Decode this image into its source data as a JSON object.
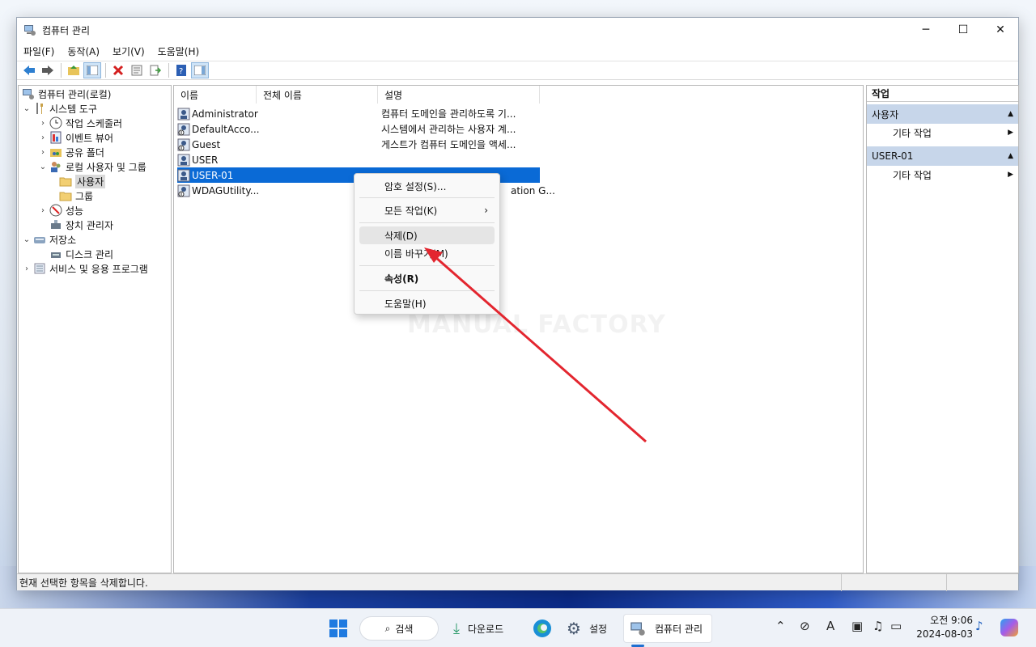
{
  "window": {
    "title": "컴퓨터 관리",
    "minimize": "─",
    "maximize": "☐",
    "close": "✕"
  },
  "menubar": [
    "파일(F)",
    "동작(A)",
    "보기(V)",
    "도움말(H)"
  ],
  "tree": {
    "root": "컴퓨터 관리(로컬)",
    "system_tools": "시스템 도구",
    "task_scheduler": "작업 스케줄러",
    "event_viewer": "이벤트 뷰어",
    "shared_folders": "공유 폴더",
    "local_users_groups": "로컬 사용자 및 그룹",
    "users": "사용자",
    "groups": "그룹",
    "performance": "성능",
    "device_manager": "장치 관리자",
    "storage": "저장소",
    "disk_management": "디스크 관리",
    "services_apps": "서비스 및 응용 프로그램"
  },
  "list": {
    "headers": [
      "이름",
      "전체 이름",
      "설명"
    ],
    "rows": [
      {
        "name": "Administrator",
        "full_name": "",
        "description": "컴퓨터 도메인을 관리하도록 기..."
      },
      {
        "name": "DefaultAcco...",
        "full_name": "",
        "description": "시스템에서 관리하는 사용자 계..."
      },
      {
        "name": "Guest",
        "full_name": "",
        "description": "게스트가 컴퓨터 도메인을 액세..."
      },
      {
        "name": "USER",
        "full_name": "",
        "description": ""
      },
      {
        "name": "USER-01",
        "full_name": "",
        "description": ""
      },
      {
        "name": "WDAGUtility...",
        "full_name": "",
        "description": "ation G..."
      }
    ]
  },
  "context_menu": {
    "set_password": "암호 설정(S)...",
    "all_tasks": "모든 작업(K)",
    "delete": "삭제(D)",
    "rename": "이름 바꾸기(M)",
    "properties": "속성(R)",
    "help": "도움말(H)"
  },
  "watermark": "MANUAL FACTORY",
  "actions": {
    "header": "작업",
    "group1": "사용자",
    "group1_item": "기타 작업",
    "group2": "USER-01",
    "group2_item": "기타 작업"
  },
  "status": "현재 선택한 항목을 삭제합니다.",
  "taskbar": {
    "search": "검색",
    "downloads": "다운로드",
    "settings": "설정",
    "computer_management": "컴퓨터 관리",
    "time": "오전 9:06",
    "date": "2024-08-03"
  },
  "colors": {
    "selection": "#0a6ad6",
    "arrow": "#e3262f",
    "action_group": "#c7d6ea"
  }
}
